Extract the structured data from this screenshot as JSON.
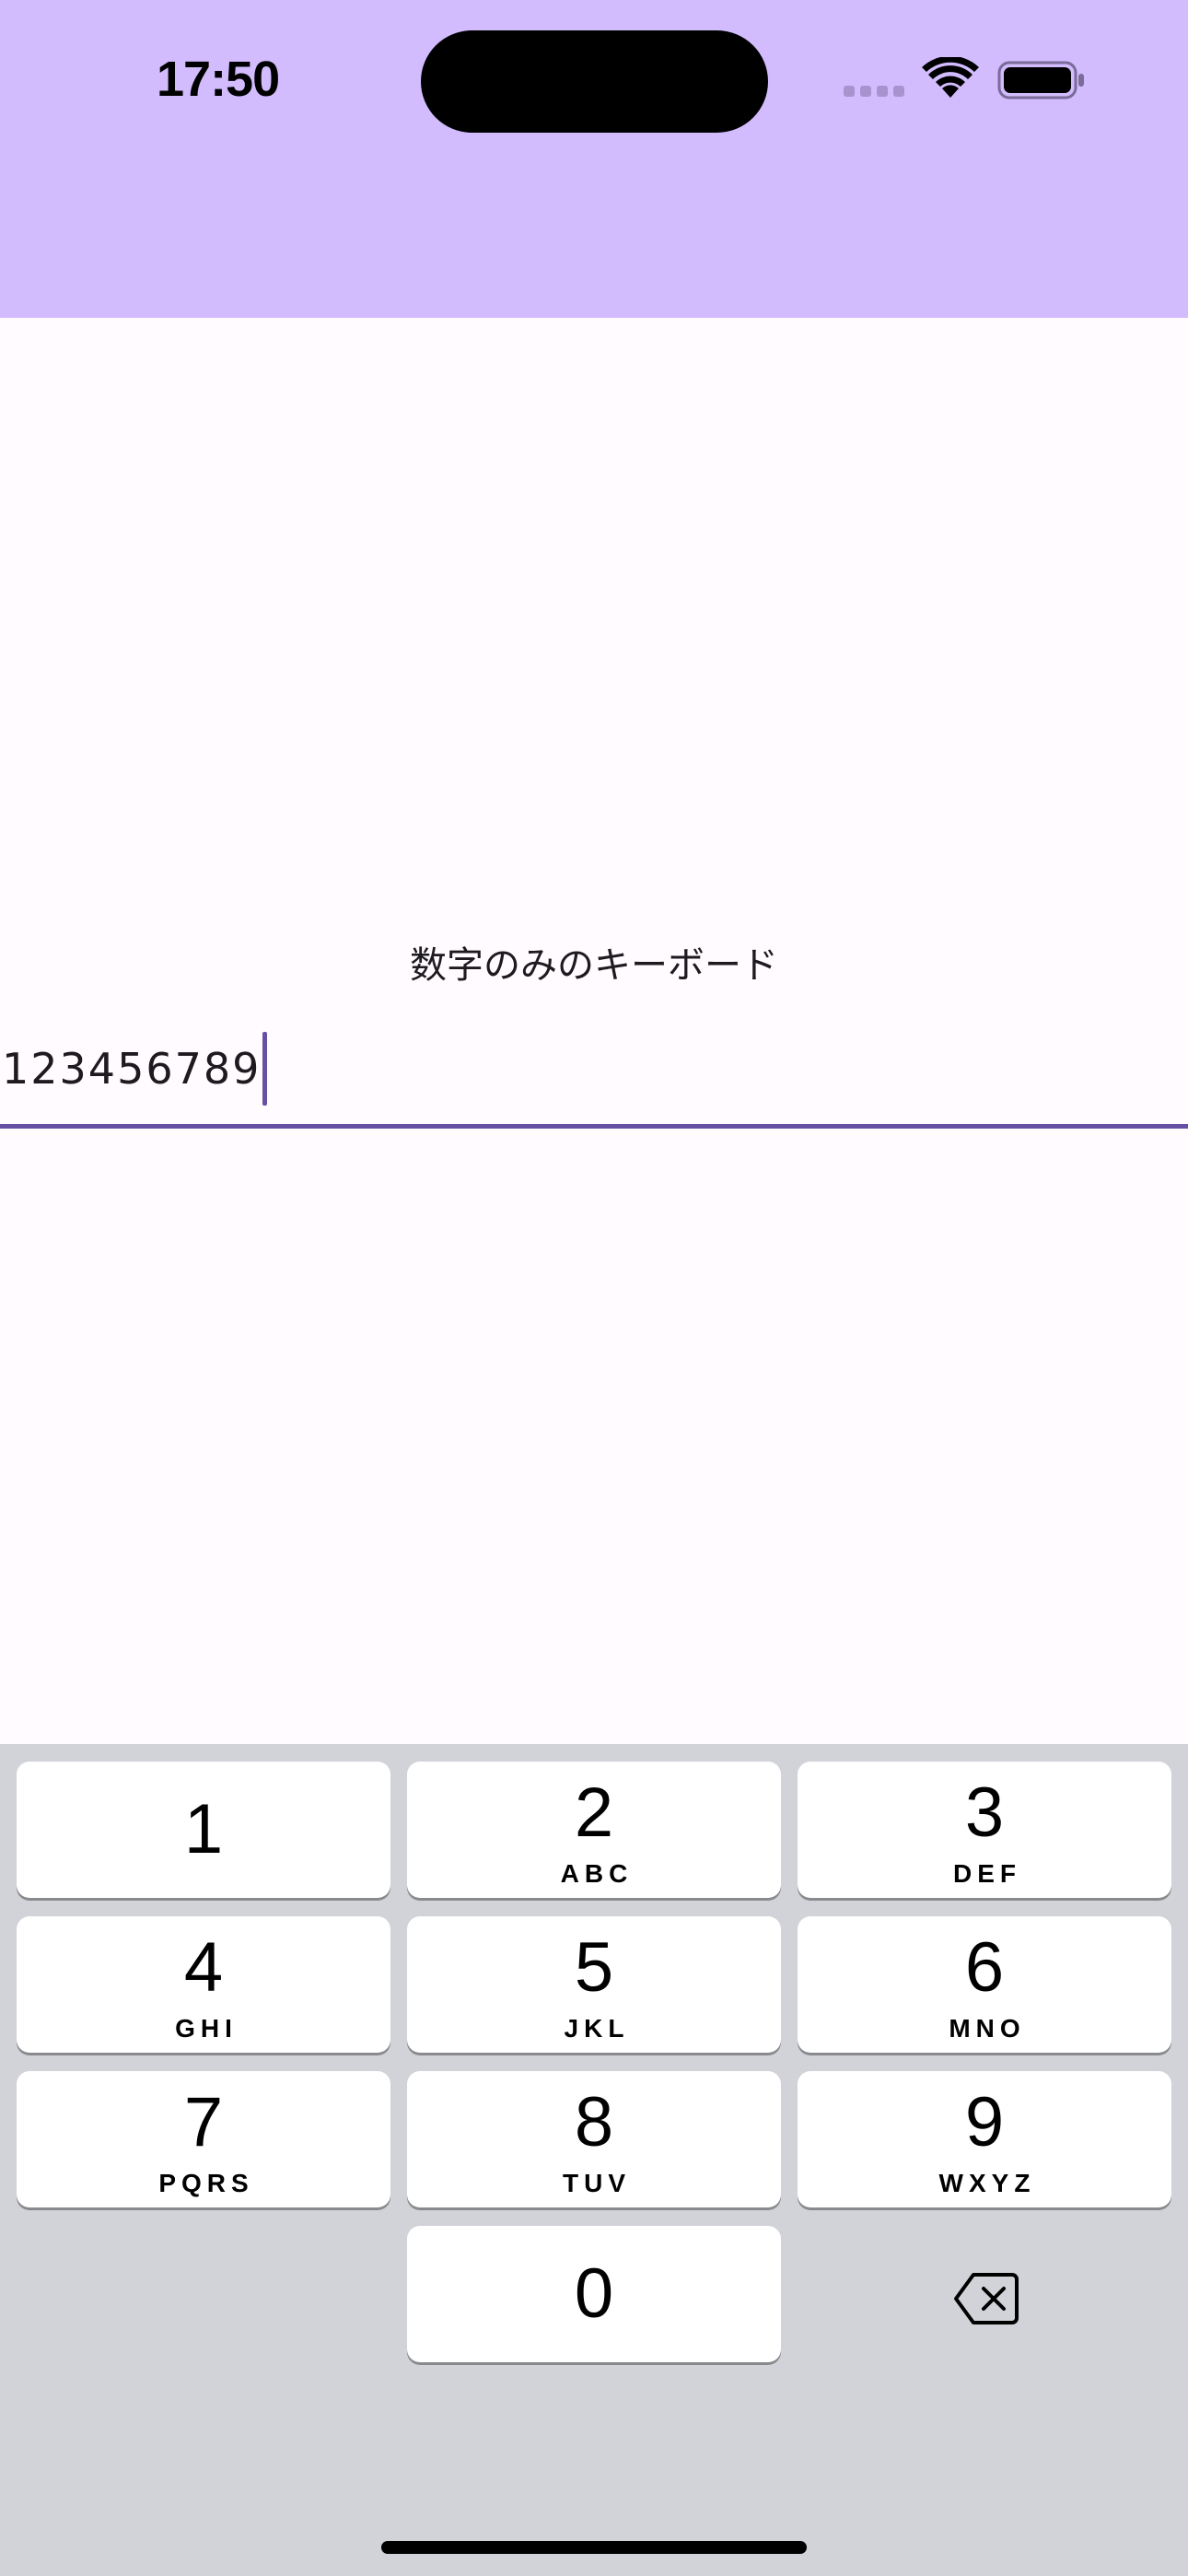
{
  "status_bar": {
    "time": "17:50",
    "icons": [
      "cellular-signal-icon",
      "wifi-icon",
      "battery-icon"
    ]
  },
  "app_bar": {
    "background_color": "#d2bcfe"
  },
  "form": {
    "label": "数字のみのキーボード",
    "value": "123456789",
    "accent_color": "#6750a4"
  },
  "keypad": {
    "keys": [
      {
        "digit": "1",
        "letters": ""
      },
      {
        "digit": "2",
        "letters": "ABC"
      },
      {
        "digit": "3",
        "letters": "DEF"
      },
      {
        "digit": "4",
        "letters": "GHI"
      },
      {
        "digit": "5",
        "letters": "JKL"
      },
      {
        "digit": "6",
        "letters": "MNO"
      },
      {
        "digit": "7",
        "letters": "PQRS"
      },
      {
        "digit": "8",
        "letters": "TUV"
      },
      {
        "digit": "9",
        "letters": "WXYZ"
      },
      {
        "digit": "0",
        "letters": ""
      }
    ],
    "delete_icon": "backspace-icon",
    "background_color": "#d1d3d9"
  }
}
